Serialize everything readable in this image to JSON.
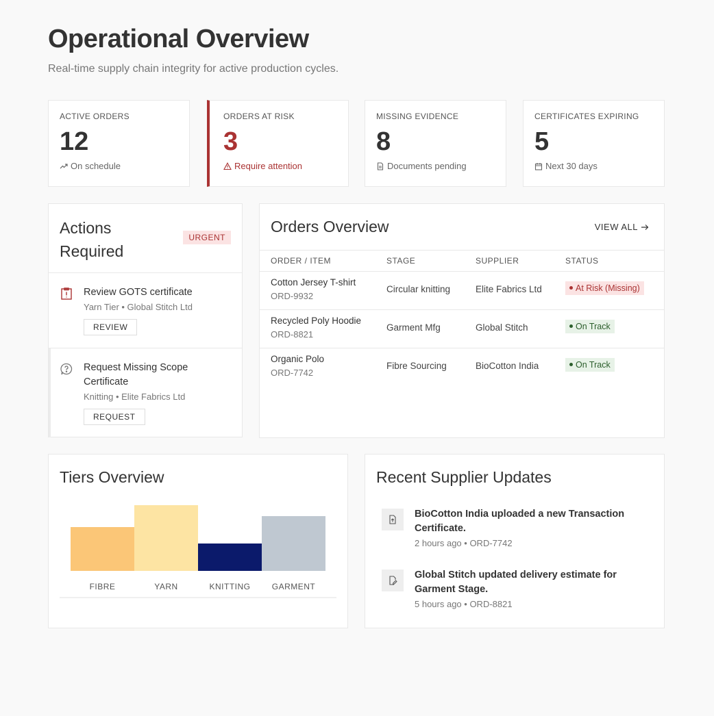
{
  "header": {
    "title": "Operational Overview",
    "subtitle": "Real-time supply chain integrity for active production cycles."
  },
  "kpis": [
    {
      "label": "ACTIVE ORDERS",
      "value": "12",
      "sub": "On schedule",
      "icon": "trend-up-icon"
    },
    {
      "label": "ORDERS AT RISK",
      "value": "3",
      "sub": "Require attention",
      "icon": "warning-icon",
      "color": "#aa3333"
    },
    {
      "label": "MISSING EVIDENCE",
      "value": "8",
      "sub": "Documents pending",
      "icon": "document-icon"
    },
    {
      "label": "CERTIFICATES EXPIRING",
      "value": "5",
      "sub": "Next 30 days",
      "icon": "calendar-icon"
    }
  ],
  "actions": {
    "title": "Actions Required",
    "badge": "URGENT",
    "items": [
      {
        "title": "Review GOTS certificate",
        "meta": "Yarn Tier • Global Stitch Ltd",
        "button": "REVIEW",
        "icon": "alert-clipboard-icon"
      },
      {
        "title": "Request Missing Scope Certificate",
        "meta": "Knitting • Elite Fabrics Ltd",
        "button": "REQUEST",
        "icon": "help-bubble-icon"
      }
    ]
  },
  "orders": {
    "title": "Orders Overview",
    "view_all": "VIEW ALL",
    "columns": [
      "ORDER / ITEM",
      "STAGE",
      "SUPPLIER",
      "STATUS"
    ],
    "rows": [
      {
        "item": "Cotton Jersey T-shirt",
        "order": "ORD-9932",
        "stage": "Circular knitting",
        "supplier": "Elite Fabrics Ltd",
        "status": "At Risk (Missing)"
      },
      {
        "item": "Recycled Poly Hoodie",
        "order": "ORD-8821",
        "stage": "Garment Mfg",
        "supplier": "Global Stitch",
        "status": "On Track"
      },
      {
        "item": "Organic Polo",
        "order": "ORD-7742",
        "stage": "Fibre Sourcing",
        "supplier": "BioCotton India",
        "status": "On Track"
      }
    ],
    "colors": {
      "risk": "#aa3333",
      "track": "#2b5e2b"
    }
  },
  "tiers": {
    "title": "Tiers Overview"
  },
  "chart_data": {
    "type": "bar",
    "categories": [
      "FIBRE",
      "YARN",
      "KNITTING",
      "GARMENT"
    ],
    "values": [
      64,
      96,
      40,
      80
    ],
    "ylim": [
      0,
      100
    ],
    "colors": [
      "#fbc677",
      "#fde4a3",
      "#0b1a6b",
      "#bfc8d1"
    ],
    "title": "",
    "xlabel": "",
    "ylabel": ""
  },
  "updates": {
    "title": "Recent Supplier Updates",
    "items": [
      {
        "title": "BioCotton India uploaded a new Transaction Certificate.",
        "meta": "2 hours ago • ORD-7742",
        "icon": "file-upload-icon"
      },
      {
        "title": "Global Stitch updated delivery estimate for Garment Stage.",
        "meta": "5 hours ago • ORD-8821",
        "icon": "file-edit-icon"
      }
    ]
  }
}
